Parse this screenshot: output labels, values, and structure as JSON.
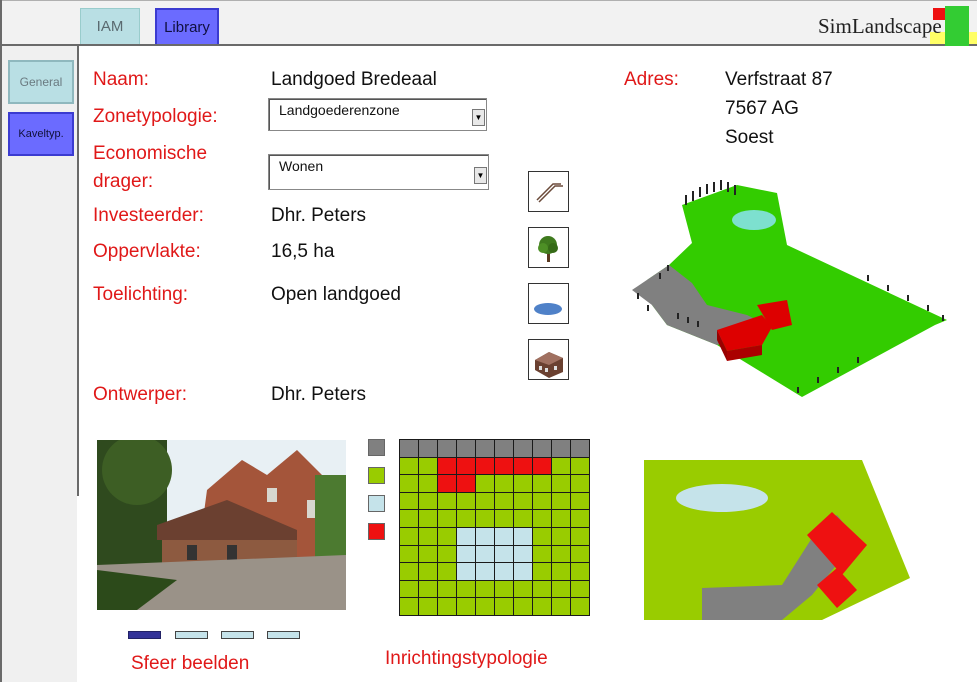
{
  "tabs": [
    {
      "label": "IAM"
    },
    {
      "label": "Library"
    }
  ],
  "brand": {
    "text_a": "SimL",
    "text_b": "andscape"
  },
  "sidebar": {
    "items": [
      {
        "label": "General"
      },
      {
        "label": "Kaveltyp."
      }
    ]
  },
  "form": {
    "naam_label": "Naam:",
    "naam_value": "Landgoed Bredeaal",
    "zonetypologie_label": "Zonetypologie:",
    "zonetypologie_value": "Landgoederenzone",
    "economische_label_1": "Economische",
    "economische_label_2": "drager:",
    "economische_value": "Wonen",
    "investeerder_label": "Investeerder:",
    "investeerder_value": "Dhr. Peters",
    "oppervlakte_label": "Oppervlakte:",
    "oppervlakte_value": "16,5 ha",
    "toelichting_label": "Toelichting:",
    "toelichting_value": "Open landgoed",
    "ontwerper_label": "Ontwerper:",
    "ontwerper_value": "Dhr. Peters"
  },
  "address": {
    "label": "Adres:",
    "line1": "Verfstraat 87",
    "line2": "7567 AG",
    "line3": "Soest"
  },
  "tools": [
    {
      "icon": "path-icon"
    },
    {
      "icon": "tree-icon"
    },
    {
      "icon": "pond-icon"
    },
    {
      "icon": "building-icon"
    }
  ],
  "legend_colors": [
    "#808080",
    "#99cc00",
    "#c5e3ea",
    "#ee1111"
  ],
  "grid": {
    "cols": 10,
    "rows": 10,
    "colors": {
      "grass": "#99cc00",
      "road": "#808080",
      "water": "#c5e3ea",
      "building": "#ee1111"
    }
  },
  "bottom": {
    "sfeer_label": "Sfeer beelden",
    "inrichting_label": "Inrichtingstypologie"
  },
  "carousel": {
    "count": 4,
    "active": 0
  }
}
